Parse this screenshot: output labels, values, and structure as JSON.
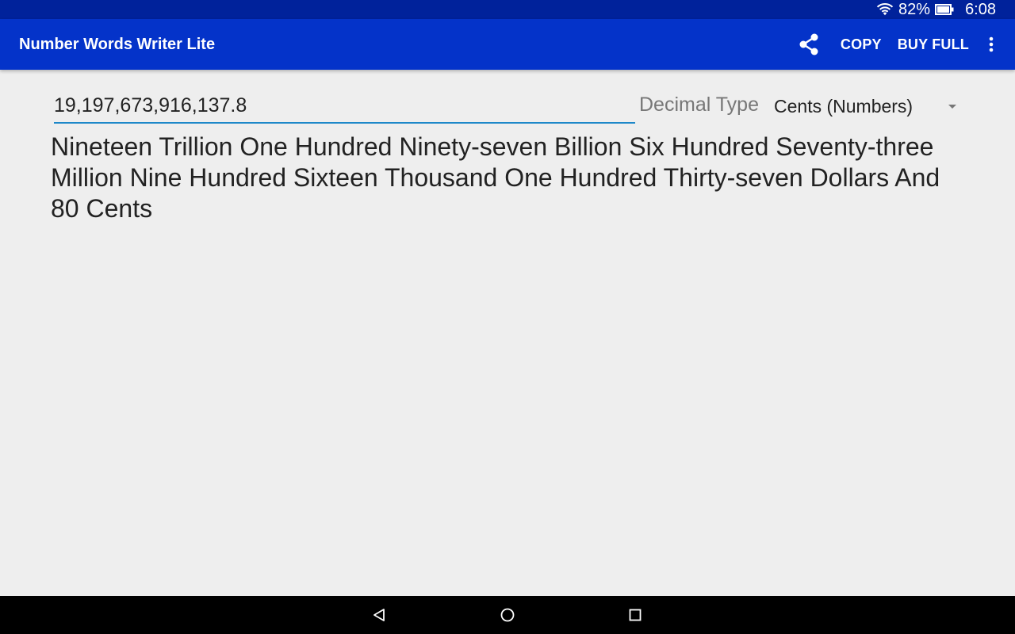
{
  "status_bar": {
    "battery_percent": "82%",
    "time": "6:08",
    "icons": [
      "wifi-icon",
      "battery-icon"
    ]
  },
  "app_bar": {
    "title": "Number Words Writer Lite",
    "share_icon": "share-icon",
    "copy_label": "COPY",
    "buy_full_label": "BUY FULL",
    "overflow_icon": "more-vert-icon"
  },
  "form": {
    "number_value": "19,197,673,916,137.8",
    "decimal_type_label": "Decimal Type",
    "decimal_type_selected": "Cents (Numbers)"
  },
  "result": {
    "words": "Nineteen Trillion One Hundred Ninety-seven Billion Six Hundred Seventy-three Million Nine Hundred Sixteen Thousand One Hundred Thirty-seven Dollars And 80 Cents"
  },
  "nav_bar": {
    "icons": [
      "back-icon",
      "home-icon",
      "recents-icon"
    ]
  },
  "colors": {
    "status_bar": "#00229b",
    "app_bar": "#0433c9",
    "accent": "#1e88c9",
    "background": "#eeeeee"
  }
}
